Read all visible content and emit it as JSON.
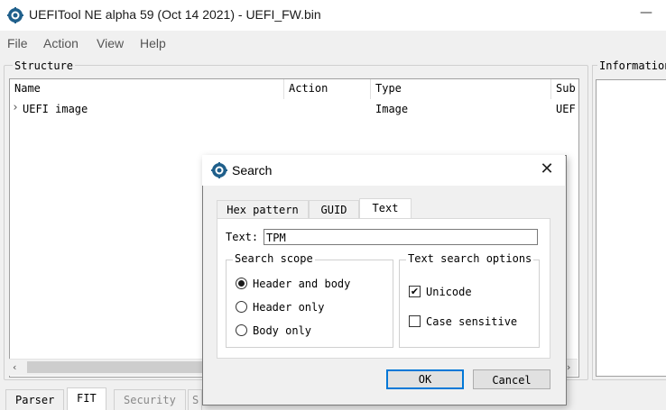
{
  "window": {
    "title": "UEFITool NE alpha 59 (Oct 14 2021) - UEFI_FW.bin",
    "minimize_glyph": "—",
    "icon": "gear-icon"
  },
  "menu": [
    "File",
    "Action",
    "View",
    "Help"
  ],
  "structure": {
    "legend": "Structure",
    "columns": [
      "Name",
      "Action",
      "Type",
      "Sub"
    ],
    "rows": [
      {
        "expander": "›",
        "name": "UEFI image",
        "action": "",
        "type": "Image",
        "subtype": "UEF"
      }
    ]
  },
  "information": {
    "legend": "Information"
  },
  "bottom_tabs": [
    "Parser",
    "FIT",
    "Security",
    "S"
  ],
  "dialog": {
    "title": "Search",
    "close_glyph": "✕",
    "tabs": [
      "Hex pattern",
      "GUID",
      "Text"
    ],
    "active_tab": "Text",
    "text_label": "Text:",
    "text_value": "TPM",
    "scope": {
      "legend": "Search scope",
      "options": [
        "Header and body",
        "Header only",
        "Body only"
      ],
      "selected": "Header and body"
    },
    "text_options": {
      "legend": "Text search options",
      "unicode_label": "Unicode",
      "unicode_checked": true,
      "case_label": "Case sensitive",
      "case_checked": false
    },
    "ok_label": "OK",
    "cancel_label": "Cancel"
  }
}
